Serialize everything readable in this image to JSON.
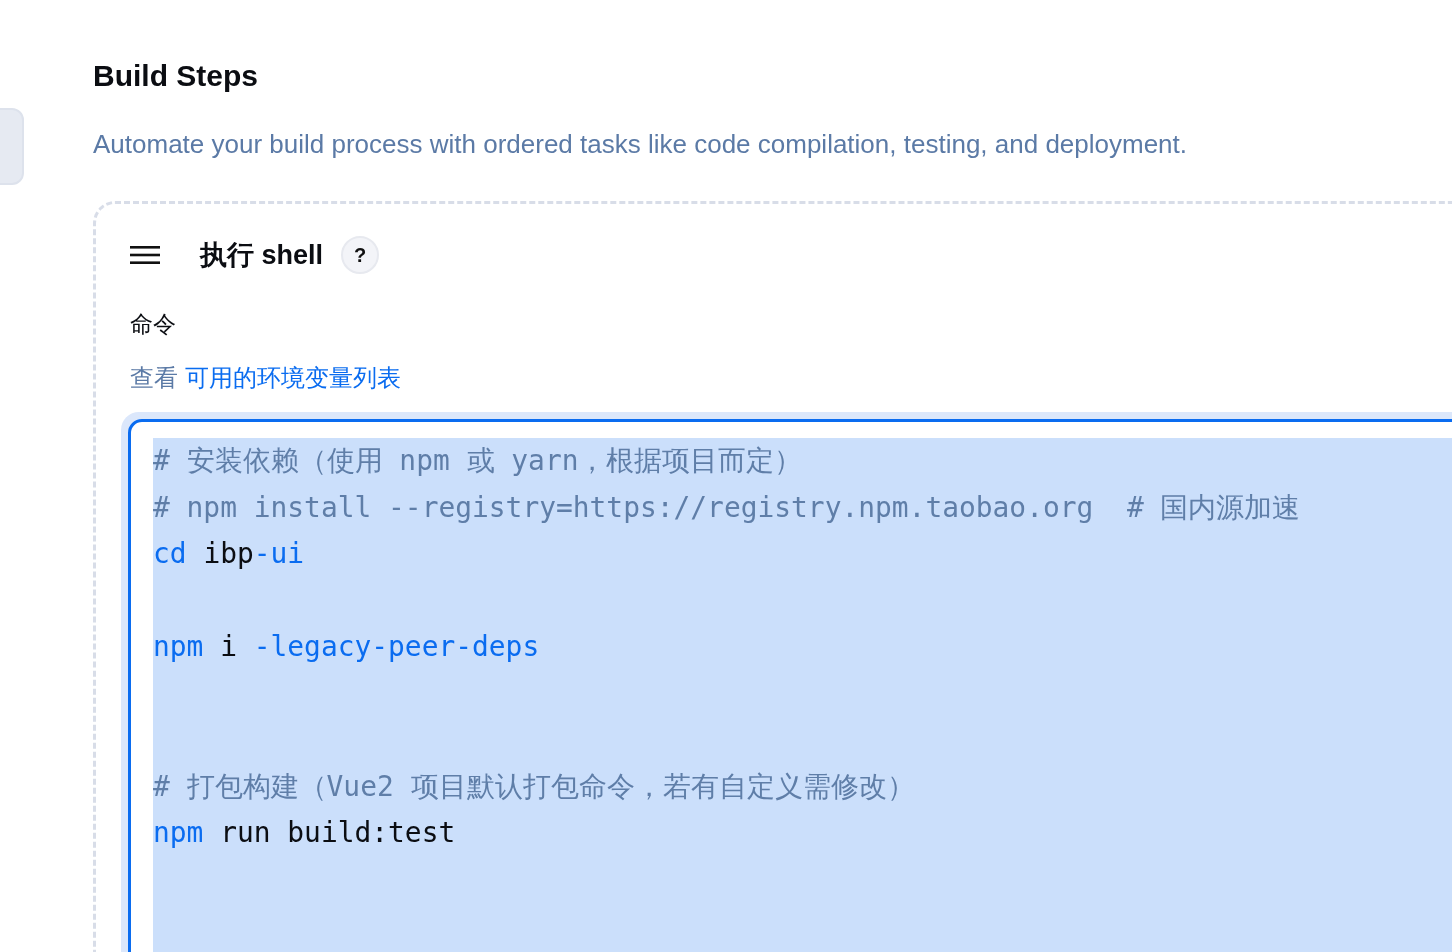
{
  "section": {
    "title": "Build Steps",
    "description": "Automate your build process with ordered tasks like code compilation, testing, and deployment."
  },
  "step": {
    "title": "执行 shell",
    "help": "?",
    "field_label": "命令",
    "hint_prefix": "查看 ",
    "hint_link": "可用的环境变量列表",
    "editor": {
      "focused": true,
      "selected": true,
      "lines": [
        {
          "tokens": [
            {
              "kind": "comment",
              "text": "# 安装依赖（使用 npm 或 yarn，根据项目而定）"
            }
          ]
        },
        {
          "tokens": [
            {
              "kind": "comment",
              "text": "# npm install --registry=https://registry.npm.taobao.org  # 国内源加速"
            }
          ]
        },
        {
          "tokens": [
            {
              "kind": "keyword",
              "text": "cd"
            },
            {
              "kind": "plain",
              "text": " ibp"
            },
            {
              "kind": "keyword",
              "text": "-ui"
            }
          ]
        },
        {
          "kind": "blank"
        },
        {
          "tokens": [
            {
              "kind": "keyword",
              "text": "npm"
            },
            {
              "kind": "plain",
              "text": " i "
            },
            {
              "kind": "keyword",
              "text": "-legacy-peer-deps"
            }
          ]
        },
        {
          "kind": "blank"
        },
        {
          "kind": "blank"
        },
        {
          "tokens": [
            {
              "kind": "comment",
              "text": "# 打包构建（Vue2 项目默认打包命令，若有自定义需修改）"
            }
          ]
        },
        {
          "tokens": [
            {
              "kind": "keyword",
              "text": "npm"
            },
            {
              "kind": "plain",
              "text": " run build:test"
            }
          ]
        }
      ]
    }
  }
}
